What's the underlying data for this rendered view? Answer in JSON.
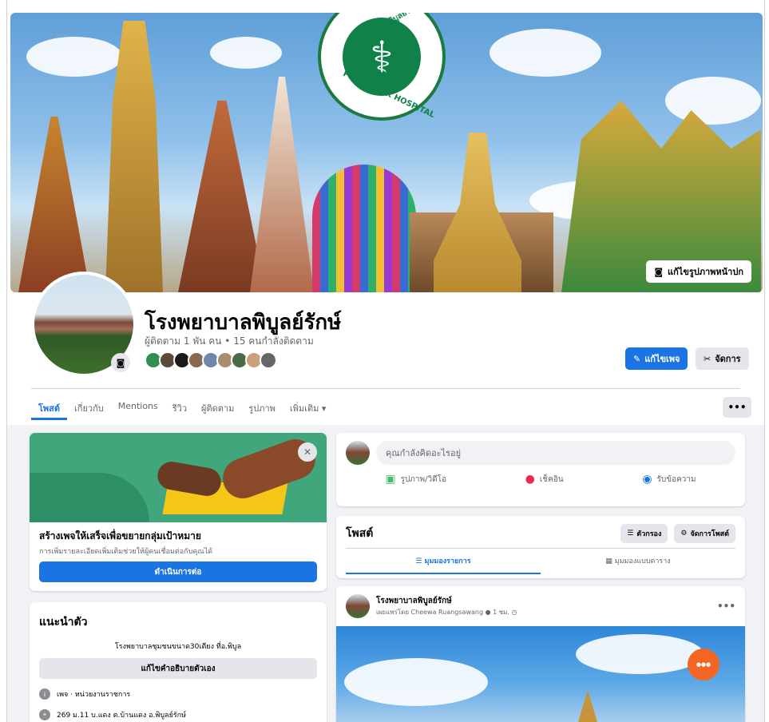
{
  "cover": {
    "logo_text_top": "โรงพยาบาลพิบูลย์รักษ์",
    "logo_text_bottom": "PHIBUNRAK HOSPITAL",
    "edit_cover_label": "แก้ไขรูปภาพหน้าปก",
    "colors": {
      "logo_green": "#11814a"
    }
  },
  "profile": {
    "name": "โรงพยาบาลพิบูลย์รักษ์",
    "followers_line": "ผู้ติดตาม 1 พัน คน • 15 คนกำลังติดตาม",
    "edit_page_label": "แก้ไขเพจ",
    "manage_label": "จัดการ",
    "follower_avatar_colors": [
      "#2f8f4e",
      "#5a4a3a",
      "#1b1b1b",
      "#8b6a4f",
      "#6f87a8",
      "#a88d6f",
      "#4a6b4a",
      "#c9a27a",
      "#666666"
    ]
  },
  "tabs": [
    {
      "label": "โพสต์",
      "active": true
    },
    {
      "label": "เกี่ยวกับ",
      "active": false
    },
    {
      "label": "Mentions",
      "active": false
    },
    {
      "label": "รีวิว",
      "active": false
    },
    {
      "label": "ผู้ติดตาม",
      "active": false
    },
    {
      "label": "รูปภาพ",
      "active": false
    },
    {
      "label": "เพิ่มเติม ▾",
      "active": false
    }
  ],
  "more_button": "•••",
  "promo": {
    "title": "สร้างเพจให้เสร็จเพื่อขยายกลุ่มเป้าหมาย",
    "subtitle": "การเพิ่มรายละเอียดเพิ่มเติมช่วยให้ผู้คนเชื่อมต่อกับคุณได้",
    "button": "ดำเนินการต่อ",
    "close": "✕"
  },
  "intro": {
    "title": "แนะนำตัว",
    "description": "โรงพยาบาลชุมชนขนาด30เตียง ที่อ.พิบูล",
    "edit_button": "แก้ไขคำอธิบายตัวเอง",
    "rows": [
      {
        "icon": "i",
        "text": "เพจ · หน่วยงานราชการ"
      },
      {
        "icon": "⌖",
        "text": "269 ม.11 บ.แดง ต.บ้านแดง อ.พิบูลย์รักษ์"
      }
    ]
  },
  "composer": {
    "placeholder": "คุณกำลังคิดอะไรอยู่",
    "actions": [
      {
        "icon": "photo-icon",
        "glyph": "▣",
        "label": "รูปภาพ/วิดีโอ",
        "color": "#45bd62"
      },
      {
        "icon": "location-icon",
        "glyph": "●",
        "label": "เช็คอิน",
        "color": "#f02849"
      },
      {
        "icon": "messenger-icon",
        "glyph": "◉",
        "label": "รับข้อความ",
        "color": "#1b74e4"
      }
    ]
  },
  "posts": {
    "title": "โพสต์",
    "filter_label": "ตัวกรอง",
    "manage_label": "จัดการโพสต์",
    "view_list": "มุมมองรายการ",
    "view_grid": "มุมมองแบบตาราง",
    "first_post": {
      "author": "โรงพยาบาลพิบูลย์รักษ์",
      "meta": "เผยแพร่โดย Cheewa Ruangsawang ● 1 ชม. ◷",
      "dots": "•••"
    }
  }
}
